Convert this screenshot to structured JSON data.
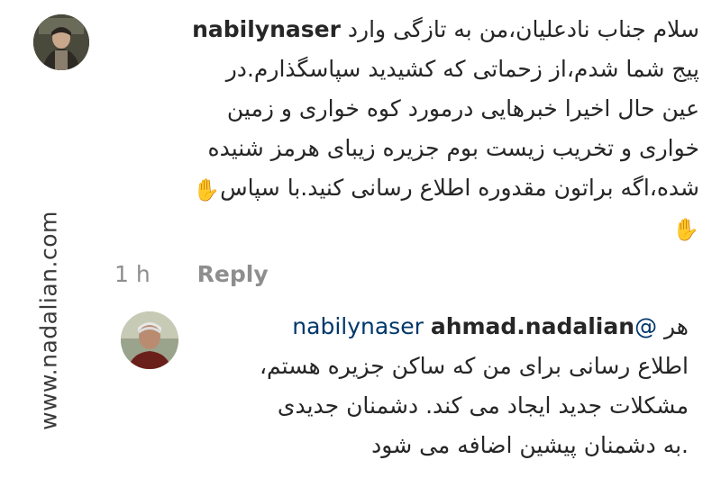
{
  "watermark": "www.nadalian.com",
  "comment": {
    "username": "nabilynaser",
    "lines": [
      "سلام جناب نادعلیان،من به تازگی وارد",
      "پیج شما شدم،از زحماتی که کشیدید سپاسگذارم.در",
      "عین حال اخیرا خبرهایی درمورد کوه خواری و زمین",
      "خواری و تخریب زیست بوم جزیره زیبای هرمز شنیده",
      "شده،اگه براتون مقدوره اطلاع رسانی کنید.با سپاس"
    ],
    "emoji": "✋",
    "time": "1 h",
    "reply_label": "Reply"
  },
  "reply": {
    "username": "ahmad.nadalian",
    "mention": "@nabilynaser",
    "first_word": "هر",
    "lines": [
      "اطلاع رسانی برای من که ساکن جزیره هستم،",
      "مشکلات جدید ایجاد می کند. دشمنان جدیدی",
      ".به دشمنان پیشین اضافه می شود"
    ]
  }
}
